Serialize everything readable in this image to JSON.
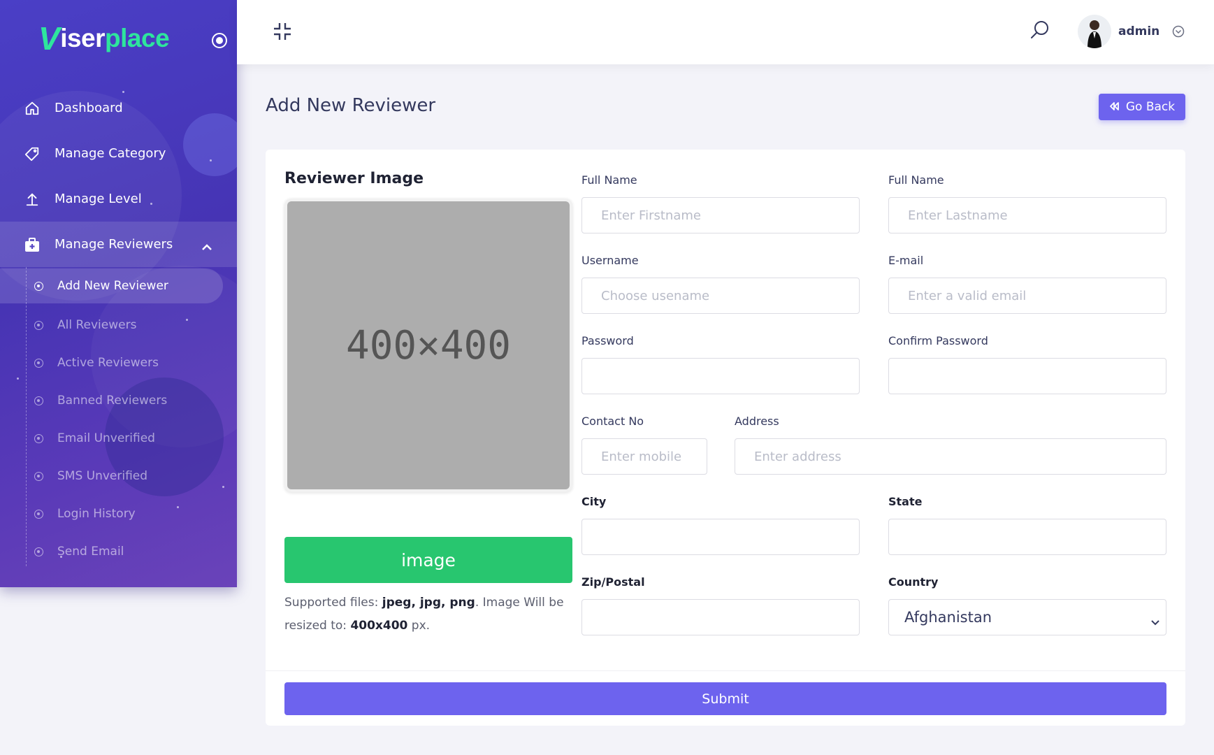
{
  "brand": {
    "letter": "V",
    "part1": "iser",
    "part2": "place",
    "color_primary": "#2ee59d"
  },
  "sidebar": {
    "items": [
      {
        "label": "Dashboard",
        "icon": "home-icon"
      },
      {
        "label": "Manage Category",
        "icon": "tag-icon"
      },
      {
        "label": "Manage Level",
        "icon": "arrow-up-icon"
      },
      {
        "label": "Manage Reviewers",
        "icon": "briefcase-plus-icon",
        "expanded": true
      }
    ],
    "submenu": [
      {
        "label": "Add New Reviewer",
        "active": true
      },
      {
        "label": "All Reviewers"
      },
      {
        "label": "Active Reviewers"
      },
      {
        "label": "Banned Reviewers"
      },
      {
        "label": "Email Unverified"
      },
      {
        "label": "SMS Unverified"
      },
      {
        "label": "Login History"
      },
      {
        "label": "Send Email"
      }
    ]
  },
  "header": {
    "user": "admin"
  },
  "page": {
    "title": "Add New Reviewer",
    "go_back": "Go Back"
  },
  "form": {
    "image": {
      "title": "Reviewer Image",
      "placeholder": "400×400",
      "button": "image",
      "help_prefix": "Supported files: ",
      "help_types": "jpeg, jpg, png",
      "help_middle": ". Image Will be resized to: ",
      "help_size": "400x400",
      "help_suffix": " px."
    },
    "firstname": {
      "label": "Full Name",
      "placeholder": "Enter Firstname"
    },
    "lastname": {
      "label": "Full Name",
      "placeholder": "Enter Lastname"
    },
    "username": {
      "label": "Username",
      "placeholder": "Choose usename"
    },
    "email": {
      "label": "E-mail",
      "placeholder": "Enter a valid email"
    },
    "password": {
      "label": "Password"
    },
    "confirm_password": {
      "label": "Confirm Password"
    },
    "contact": {
      "label": "Contact No",
      "placeholder": "Enter mobile"
    },
    "address": {
      "label": "Address",
      "placeholder": "Enter address"
    },
    "city": {
      "label": "City"
    },
    "state": {
      "label": "State"
    },
    "zip": {
      "label": "Zip/Postal"
    },
    "country": {
      "label": "Country",
      "value": "Afghanistan"
    },
    "submit": "Submit"
  },
  "colors": {
    "accent": "#6d63ee",
    "success": "#28c66f",
    "sidebar": "#4a3fc6"
  }
}
